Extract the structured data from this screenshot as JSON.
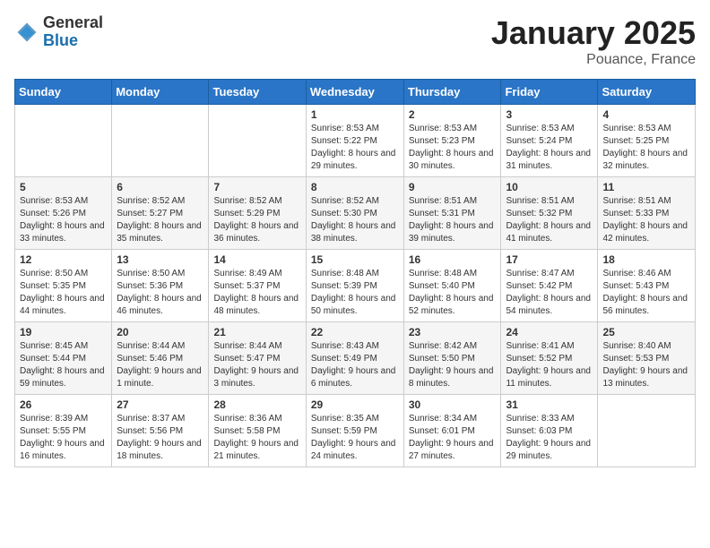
{
  "header": {
    "logo_general": "General",
    "logo_blue": "Blue",
    "title": "January 2025",
    "location": "Pouance, France"
  },
  "days_of_week": [
    "Sunday",
    "Monday",
    "Tuesday",
    "Wednesday",
    "Thursday",
    "Friday",
    "Saturday"
  ],
  "weeks": [
    [
      {
        "day": "",
        "info": ""
      },
      {
        "day": "",
        "info": ""
      },
      {
        "day": "",
        "info": ""
      },
      {
        "day": "1",
        "info": "Sunrise: 8:53 AM\nSunset: 5:22 PM\nDaylight: 8 hours and 29 minutes."
      },
      {
        "day": "2",
        "info": "Sunrise: 8:53 AM\nSunset: 5:23 PM\nDaylight: 8 hours and 30 minutes."
      },
      {
        "day": "3",
        "info": "Sunrise: 8:53 AM\nSunset: 5:24 PM\nDaylight: 8 hours and 31 minutes."
      },
      {
        "day": "4",
        "info": "Sunrise: 8:53 AM\nSunset: 5:25 PM\nDaylight: 8 hours and 32 minutes."
      }
    ],
    [
      {
        "day": "5",
        "info": "Sunrise: 8:53 AM\nSunset: 5:26 PM\nDaylight: 8 hours and 33 minutes."
      },
      {
        "day": "6",
        "info": "Sunrise: 8:52 AM\nSunset: 5:27 PM\nDaylight: 8 hours and 35 minutes."
      },
      {
        "day": "7",
        "info": "Sunrise: 8:52 AM\nSunset: 5:29 PM\nDaylight: 8 hours and 36 minutes."
      },
      {
        "day": "8",
        "info": "Sunrise: 8:52 AM\nSunset: 5:30 PM\nDaylight: 8 hours and 38 minutes."
      },
      {
        "day": "9",
        "info": "Sunrise: 8:51 AM\nSunset: 5:31 PM\nDaylight: 8 hours and 39 minutes."
      },
      {
        "day": "10",
        "info": "Sunrise: 8:51 AM\nSunset: 5:32 PM\nDaylight: 8 hours and 41 minutes."
      },
      {
        "day": "11",
        "info": "Sunrise: 8:51 AM\nSunset: 5:33 PM\nDaylight: 8 hours and 42 minutes."
      }
    ],
    [
      {
        "day": "12",
        "info": "Sunrise: 8:50 AM\nSunset: 5:35 PM\nDaylight: 8 hours and 44 minutes."
      },
      {
        "day": "13",
        "info": "Sunrise: 8:50 AM\nSunset: 5:36 PM\nDaylight: 8 hours and 46 minutes."
      },
      {
        "day": "14",
        "info": "Sunrise: 8:49 AM\nSunset: 5:37 PM\nDaylight: 8 hours and 48 minutes."
      },
      {
        "day": "15",
        "info": "Sunrise: 8:48 AM\nSunset: 5:39 PM\nDaylight: 8 hours and 50 minutes."
      },
      {
        "day": "16",
        "info": "Sunrise: 8:48 AM\nSunset: 5:40 PM\nDaylight: 8 hours and 52 minutes."
      },
      {
        "day": "17",
        "info": "Sunrise: 8:47 AM\nSunset: 5:42 PM\nDaylight: 8 hours and 54 minutes."
      },
      {
        "day": "18",
        "info": "Sunrise: 8:46 AM\nSunset: 5:43 PM\nDaylight: 8 hours and 56 minutes."
      }
    ],
    [
      {
        "day": "19",
        "info": "Sunrise: 8:45 AM\nSunset: 5:44 PM\nDaylight: 8 hours and 59 minutes."
      },
      {
        "day": "20",
        "info": "Sunrise: 8:44 AM\nSunset: 5:46 PM\nDaylight: 9 hours and 1 minute."
      },
      {
        "day": "21",
        "info": "Sunrise: 8:44 AM\nSunset: 5:47 PM\nDaylight: 9 hours and 3 minutes."
      },
      {
        "day": "22",
        "info": "Sunrise: 8:43 AM\nSunset: 5:49 PM\nDaylight: 9 hours and 6 minutes."
      },
      {
        "day": "23",
        "info": "Sunrise: 8:42 AM\nSunset: 5:50 PM\nDaylight: 9 hours and 8 minutes."
      },
      {
        "day": "24",
        "info": "Sunrise: 8:41 AM\nSunset: 5:52 PM\nDaylight: 9 hours and 11 minutes."
      },
      {
        "day": "25",
        "info": "Sunrise: 8:40 AM\nSunset: 5:53 PM\nDaylight: 9 hours and 13 minutes."
      }
    ],
    [
      {
        "day": "26",
        "info": "Sunrise: 8:39 AM\nSunset: 5:55 PM\nDaylight: 9 hours and 16 minutes."
      },
      {
        "day": "27",
        "info": "Sunrise: 8:37 AM\nSunset: 5:56 PM\nDaylight: 9 hours and 18 minutes."
      },
      {
        "day": "28",
        "info": "Sunrise: 8:36 AM\nSunset: 5:58 PM\nDaylight: 9 hours and 21 minutes."
      },
      {
        "day": "29",
        "info": "Sunrise: 8:35 AM\nSunset: 5:59 PM\nDaylight: 9 hours and 24 minutes."
      },
      {
        "day": "30",
        "info": "Sunrise: 8:34 AM\nSunset: 6:01 PM\nDaylight: 9 hours and 27 minutes."
      },
      {
        "day": "31",
        "info": "Sunrise: 8:33 AM\nSunset: 6:03 PM\nDaylight: 9 hours and 29 minutes."
      },
      {
        "day": "",
        "info": ""
      }
    ]
  ]
}
